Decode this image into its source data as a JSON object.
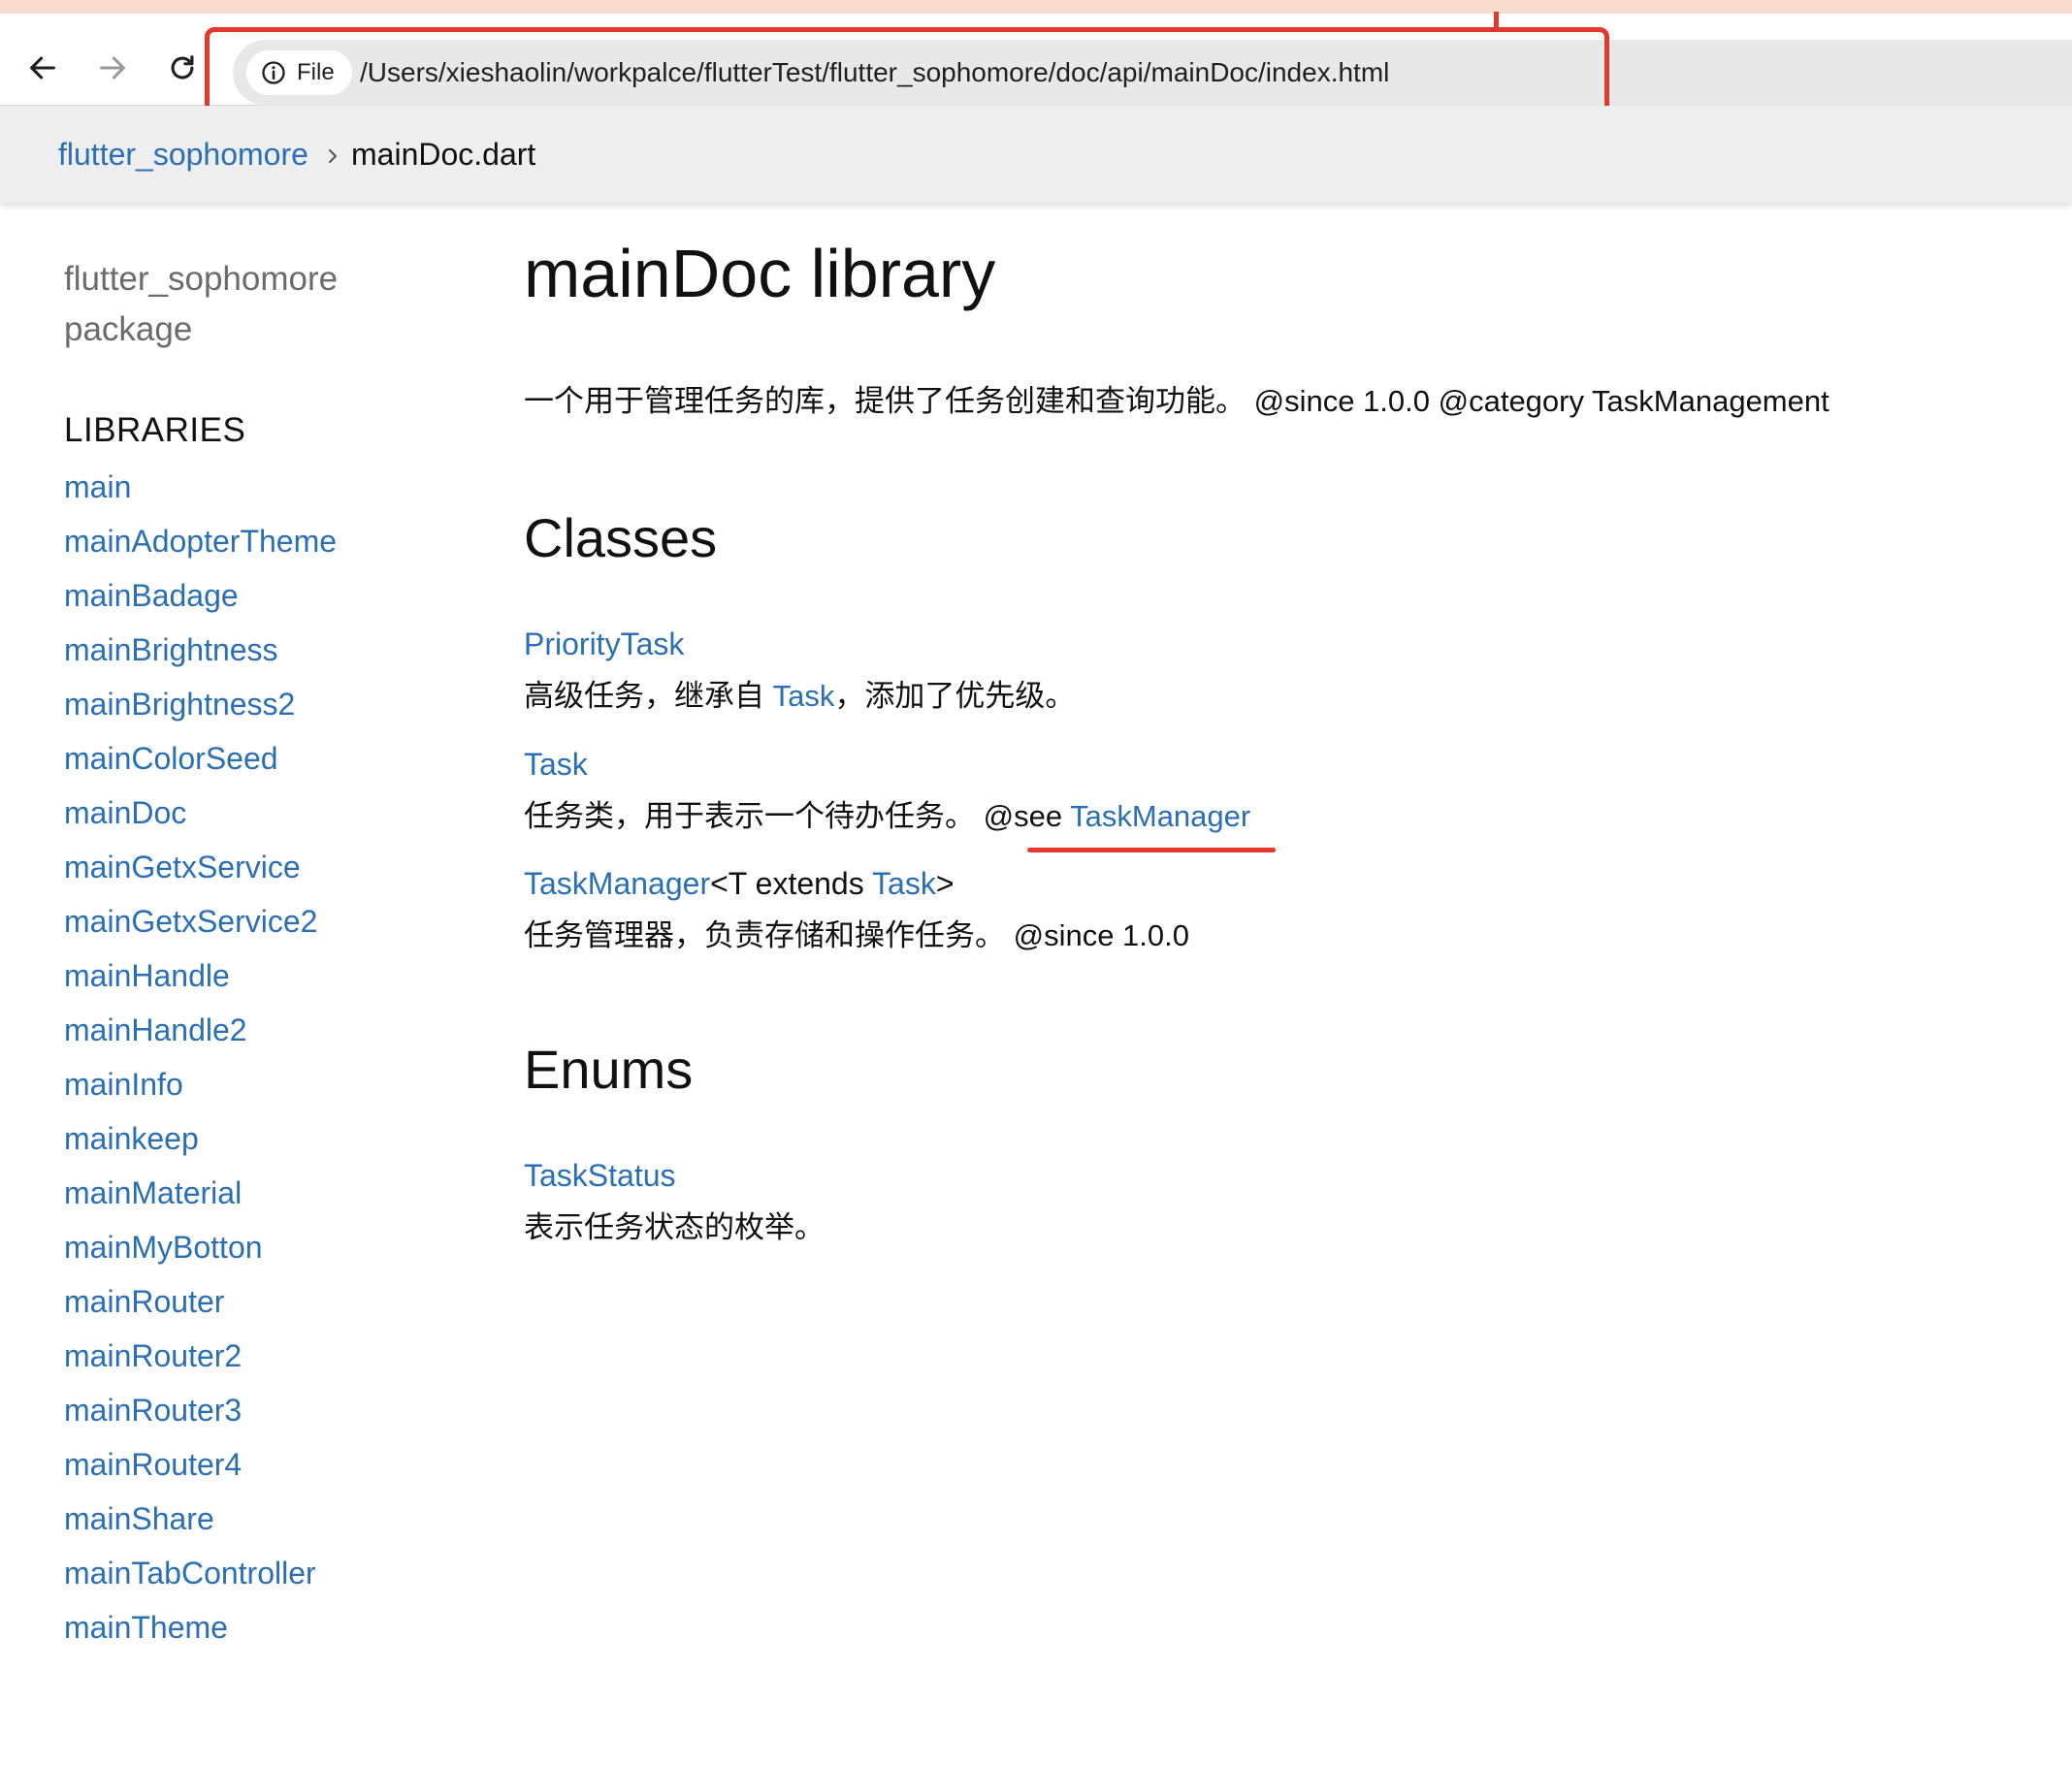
{
  "browser": {
    "chip_label": "File",
    "url": "/Users/xieshaolin/workpalce/flutterTest/flutter_sophomore/doc/api/mainDoc/index.html"
  },
  "breadcrumb": {
    "package": "flutter_sophomore",
    "current": "mainDoc.dart"
  },
  "sidebar": {
    "package_name": "flutter_sophomore",
    "package_label": "package",
    "libraries_heading": "LIBRARIES",
    "libraries": [
      "main",
      "mainAdopterTheme",
      "mainBadage",
      "mainBrightness",
      "mainBrightness2",
      "mainColorSeed",
      "mainDoc",
      "mainGetxService",
      "mainGetxService2",
      "mainHandle",
      "mainHandle2",
      "mainInfo",
      "mainkeep",
      "mainMaterial",
      "mainMyBotton",
      "mainRouter",
      "mainRouter2",
      "mainRouter3",
      "mainRouter4",
      "mainShare",
      "mainTabController",
      "mainTheme"
    ]
  },
  "main": {
    "title": "mainDoc library",
    "description": "一个用于管理任务的库，提供了任务创建和查询功能。 @since 1.0.0 @category TaskManagement",
    "classes_heading": "Classes",
    "classes": [
      {
        "name": "PriorityTask",
        "desc_before": "高级任务，继承自 ",
        "desc_link": "Task",
        "desc_after": "，添加了优先级。"
      },
      {
        "name": "Task",
        "desc_before": "任务类，用于表示一个待办任务。 @see ",
        "desc_link": "TaskManager"
      },
      {
        "name": "TaskManager",
        "generic_open": "<T extends ",
        "generic_link": "Task",
        "generic_close": ">",
        "desc": "任务管理器，负责存储和操作任务。 @since 1.0.0"
      }
    ],
    "enums_heading": "Enums",
    "enums": [
      {
        "name": "TaskStatus",
        "desc": "表示任务状态的枚举。"
      }
    ]
  },
  "colors": {
    "link": "#2a6fb5",
    "annotation_red": "#e5372c",
    "breadcrumb_bg": "#eeeeee"
  },
  "icons": [
    "back-arrow-icon",
    "forward-arrow-icon",
    "reload-icon",
    "info-icon",
    "chevron-right-icon"
  ]
}
